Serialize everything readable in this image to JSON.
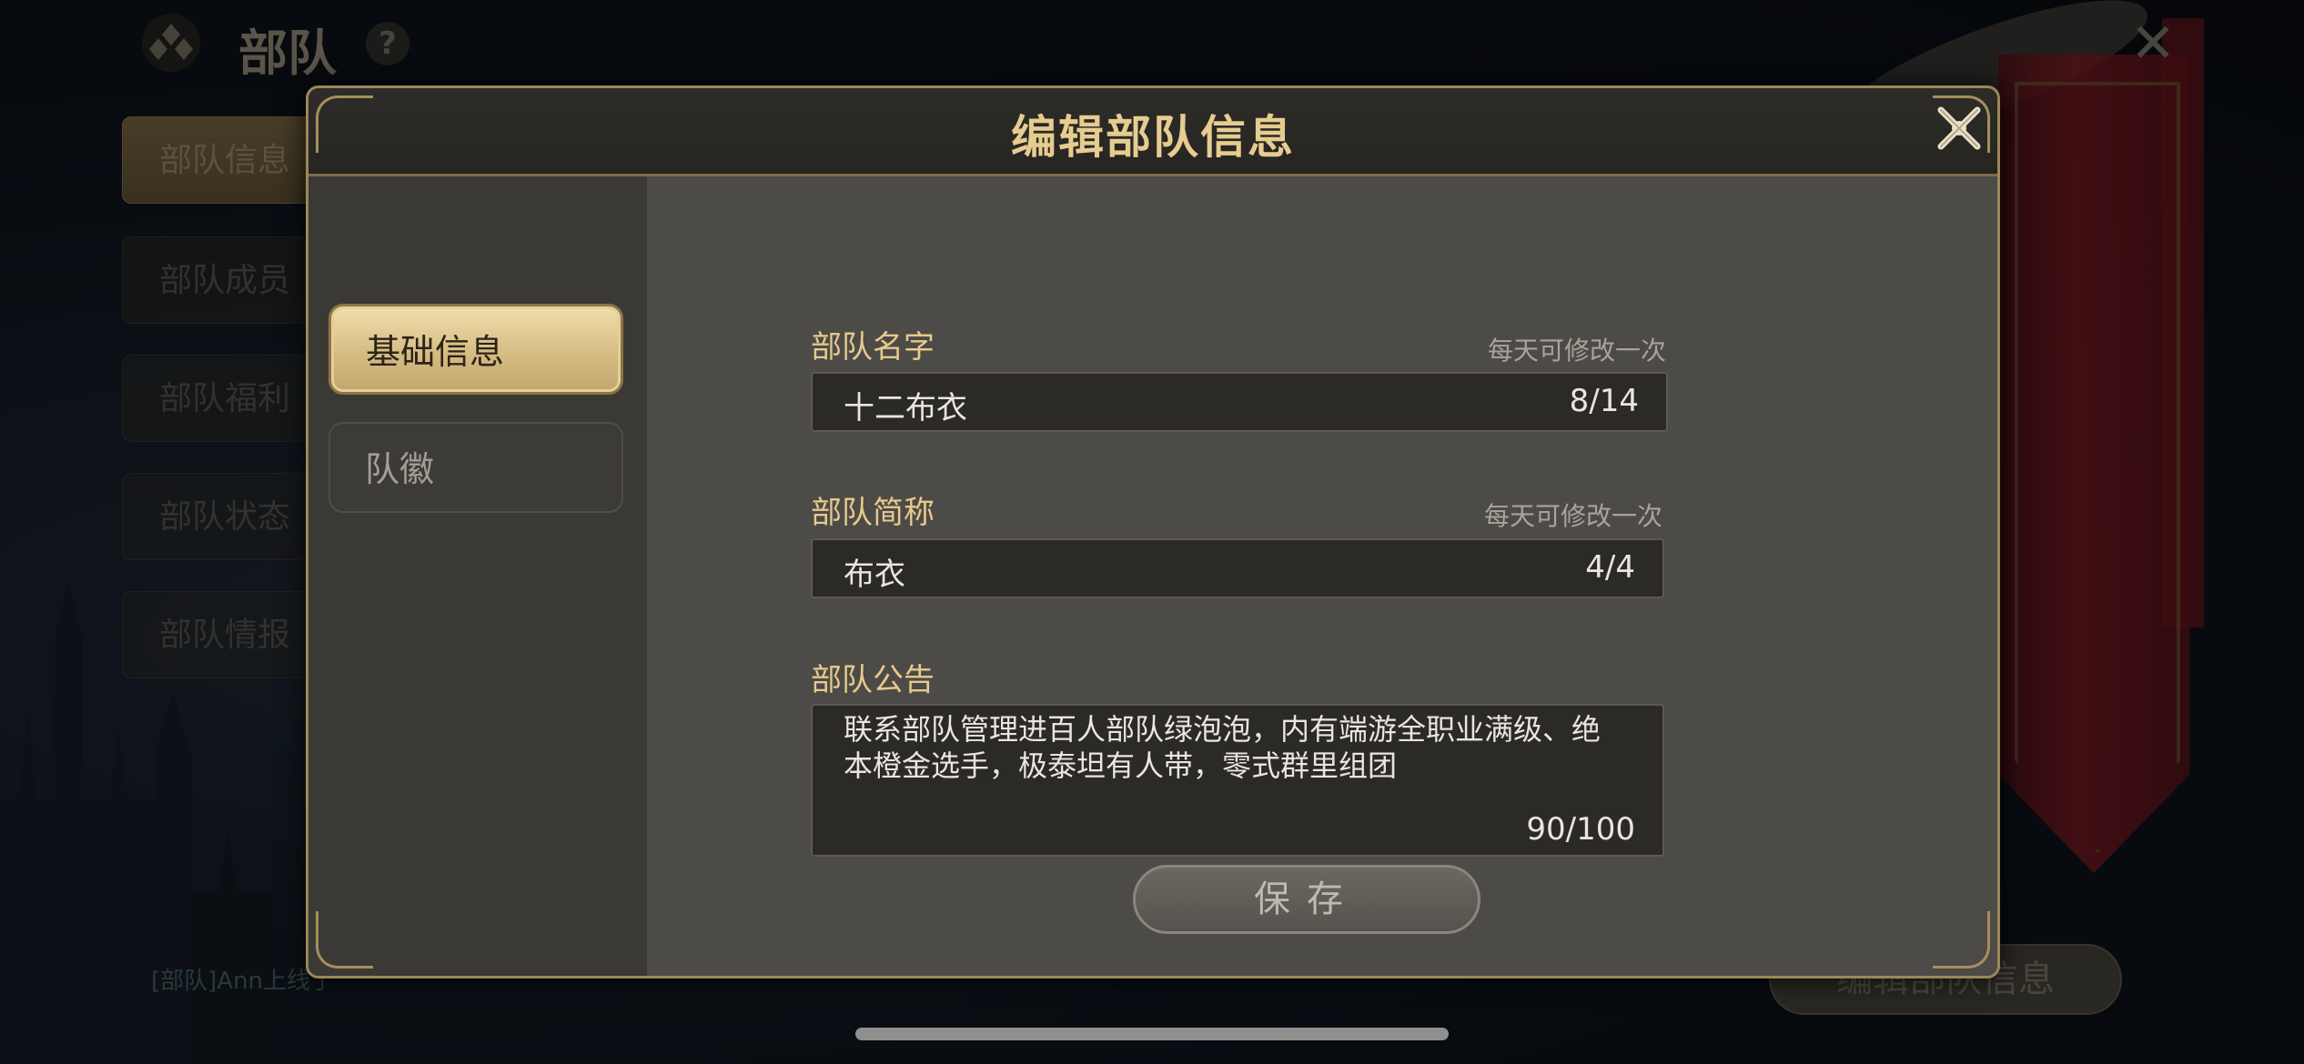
{
  "background": {
    "title": "部队",
    "help_label": "?",
    "nav_items": [
      "部队信息",
      "部队成员",
      "部队福利",
      "部队状态",
      "部队情报"
    ],
    "chat_line": "[部队]Ann上线了",
    "edit_button_label": "编辑部队信息"
  },
  "dialog": {
    "title": "编辑部队信息",
    "tabs": [
      {
        "label": "基础信息",
        "active": true
      },
      {
        "label": "队徽",
        "active": false
      }
    ],
    "fields": {
      "name": {
        "label": "部队名字",
        "hint": "每天可修改一次",
        "value": "十二布衣",
        "count": "8/14"
      },
      "short_name": {
        "label": "部队简称",
        "hint": "每天可修改一次",
        "value": "布衣",
        "count": "4/4"
      },
      "notice": {
        "label": "部队公告",
        "value": "联系部队管理进百人部队绿泡泡，内有端游全职业满级、绝本橙金选手，极泰坦有人带，零式群里组团",
        "count": "90/100"
      }
    },
    "save_label": "保存"
  },
  "colors": {
    "gold_accent": "#e6c98c",
    "title_gold": "#e6cd8f",
    "dialog_bg": "#4d4b47",
    "banner_red": "#7a1820"
  }
}
